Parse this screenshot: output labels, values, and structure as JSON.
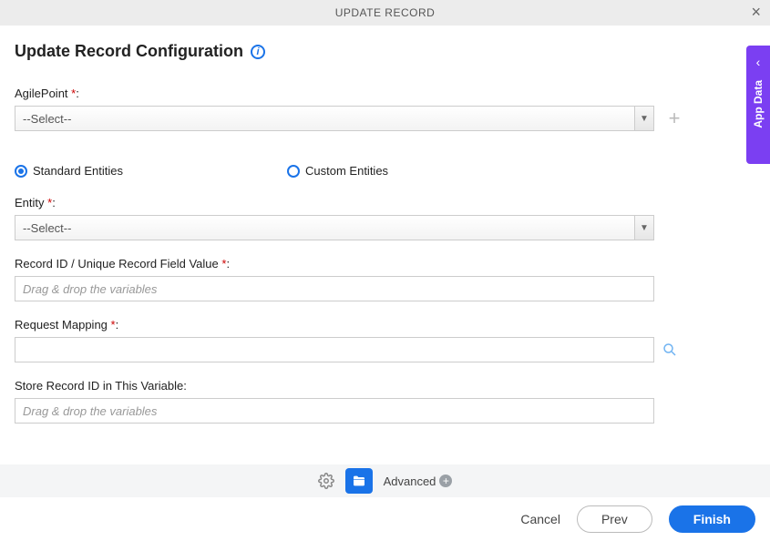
{
  "header": {
    "title": "UPDATE RECORD"
  },
  "side_panel": {
    "label": "App Data"
  },
  "page": {
    "title": "Update Record Configuration"
  },
  "fields": {
    "agilepoint": {
      "label": "AgilePoint",
      "placeholder": "--Select--"
    },
    "entity_type": {
      "standard": "Standard Entities",
      "custom": "Custom Entities"
    },
    "entity": {
      "label": "Entity",
      "placeholder": "--Select--"
    },
    "record_id": {
      "label": "Record ID / Unique Record Field Value",
      "placeholder": "Drag & drop the variables"
    },
    "request_mapping": {
      "label": "Request Mapping",
      "value": ""
    },
    "store_var": {
      "label": "Store Record ID in This Variable:",
      "placeholder": "Drag & drop the variables"
    }
  },
  "advanced": {
    "label": "Advanced"
  },
  "footer": {
    "cancel": "Cancel",
    "prev": "Prev",
    "finish": "Finish"
  }
}
